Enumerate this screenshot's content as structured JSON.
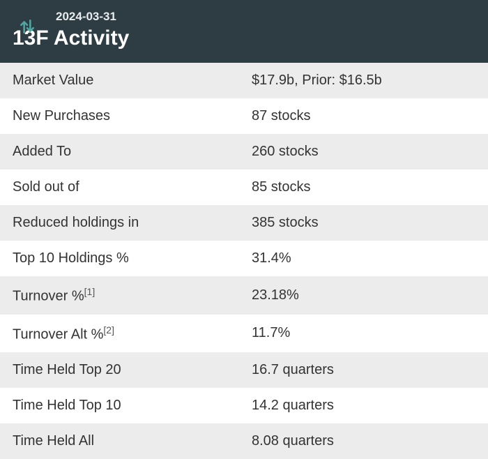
{
  "header": {
    "date": "2024-03-31",
    "title": "13F Activity"
  },
  "rows": [
    {
      "label": "Market Value",
      "sup": "",
      "value": "$17.9b, Prior: $16.5b"
    },
    {
      "label": "New Purchases",
      "sup": "",
      "value": "87 stocks"
    },
    {
      "label": "Added To",
      "sup": "",
      "value": "260 stocks"
    },
    {
      "label": "Sold out of",
      "sup": "",
      "value": "85 stocks"
    },
    {
      "label": "Reduced holdings in",
      "sup": "",
      "value": "385 stocks"
    },
    {
      "label": "Top 10 Holdings %",
      "sup": "",
      "value": "31.4%"
    },
    {
      "label": "Turnover %",
      "sup": "[1]",
      "value": "23.18%"
    },
    {
      "label": "Turnover Alt %",
      "sup": "[2]",
      "value": "11.7%"
    },
    {
      "label": "Time Held Top 20",
      "sup": "",
      "value": "16.7 quarters"
    },
    {
      "label": "Time Held Top 10",
      "sup": "",
      "value": "14.2 quarters"
    },
    {
      "label": "Time Held All",
      "sup": "",
      "value": "8.08 quarters"
    }
  ]
}
